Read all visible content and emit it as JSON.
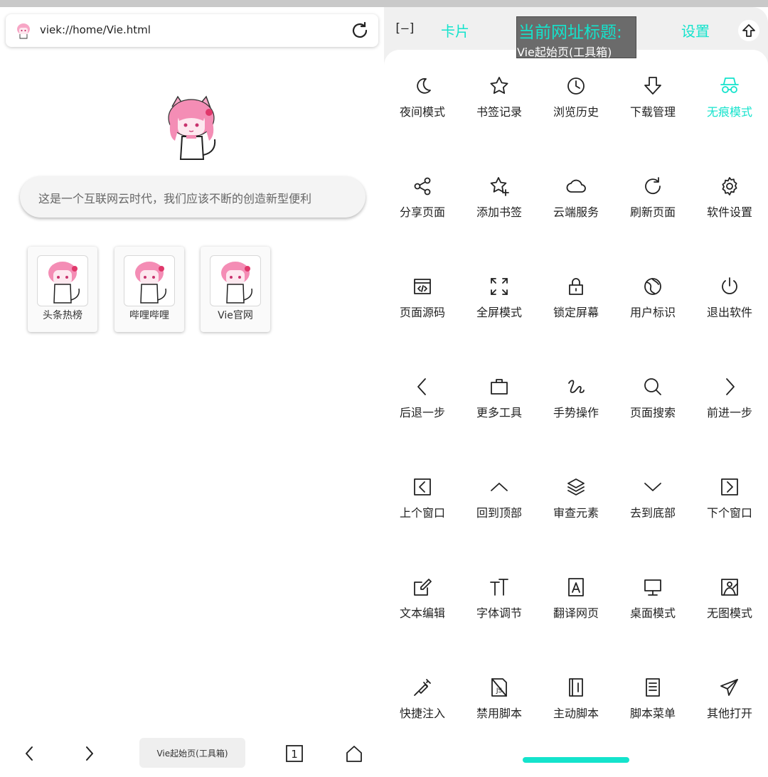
{
  "browser": {
    "url": "viek://home/Vie.html",
    "search_placeholder": "这是一个互联网云时代，我们应该不断的创造新型便利",
    "shortcuts": [
      {
        "label": "头条热榜"
      },
      {
        "label": "哔哩哔哩"
      },
      {
        "label": "Vie官网"
      }
    ],
    "bottom_nav": {
      "page_title": "Vie起始页(工具箱)",
      "tab_count": "1"
    }
  },
  "menu": {
    "header": {
      "collapse_label": "[–]",
      "card_label": "卡片",
      "settings_label": "设置",
      "title_heading": "当前网址标题:",
      "title_value": "Vie起始页(工具箱)"
    },
    "accent_color": "#14e3cc",
    "items": [
      {
        "label": "夜间模式",
        "icon": "moon-icon"
      },
      {
        "label": "书签记录",
        "icon": "star-icon"
      },
      {
        "label": "浏览历史",
        "icon": "clock-icon"
      },
      {
        "label": "下载管理",
        "icon": "download-icon"
      },
      {
        "label": "无痕模式",
        "icon": "incognito-icon",
        "active": true
      },
      {
        "label": "分享页面",
        "icon": "share-icon"
      },
      {
        "label": "添加书签",
        "icon": "star-add-icon"
      },
      {
        "label": "云端服务",
        "icon": "cloud-icon"
      },
      {
        "label": "刷新页面",
        "icon": "refresh-icon"
      },
      {
        "label": "软件设置",
        "icon": "gear-icon"
      },
      {
        "label": "页面源码",
        "icon": "source-code-icon"
      },
      {
        "label": "全屏模式",
        "icon": "fullscreen-icon"
      },
      {
        "label": "锁定屏幕",
        "icon": "lock-icon"
      },
      {
        "label": "用户标识",
        "icon": "globe-icon"
      },
      {
        "label": "退出软件",
        "icon": "power-icon"
      },
      {
        "label": "后退一步",
        "icon": "chevron-left-icon"
      },
      {
        "label": "更多工具",
        "icon": "briefcase-icon"
      },
      {
        "label": "手势操作",
        "icon": "gesture-icon"
      },
      {
        "label": "页面搜索",
        "icon": "search-icon"
      },
      {
        "label": "前进一步",
        "icon": "chevron-right-icon"
      },
      {
        "label": "上个窗口",
        "icon": "prev-window-icon"
      },
      {
        "label": "回到顶部",
        "icon": "chevron-up-icon"
      },
      {
        "label": "审查元素",
        "icon": "layers-icon"
      },
      {
        "label": "去到底部",
        "icon": "chevron-down-icon"
      },
      {
        "label": "下个窗口",
        "icon": "next-window-icon"
      },
      {
        "label": "文本编辑",
        "icon": "edit-icon"
      },
      {
        "label": "字体调节",
        "icon": "font-size-icon"
      },
      {
        "label": "翻译网页",
        "icon": "translate-icon"
      },
      {
        "label": "桌面模式",
        "icon": "desktop-icon"
      },
      {
        "label": "无图模式",
        "icon": "image-off-icon"
      },
      {
        "label": "快捷注入",
        "icon": "injector-icon"
      },
      {
        "label": "禁用脚本",
        "icon": "script-off-icon"
      },
      {
        "label": "主动脚本",
        "icon": "script-active-icon"
      },
      {
        "label": "脚本菜单",
        "icon": "script-menu-icon"
      },
      {
        "label": "其他打开",
        "icon": "send-icon"
      }
    ]
  }
}
